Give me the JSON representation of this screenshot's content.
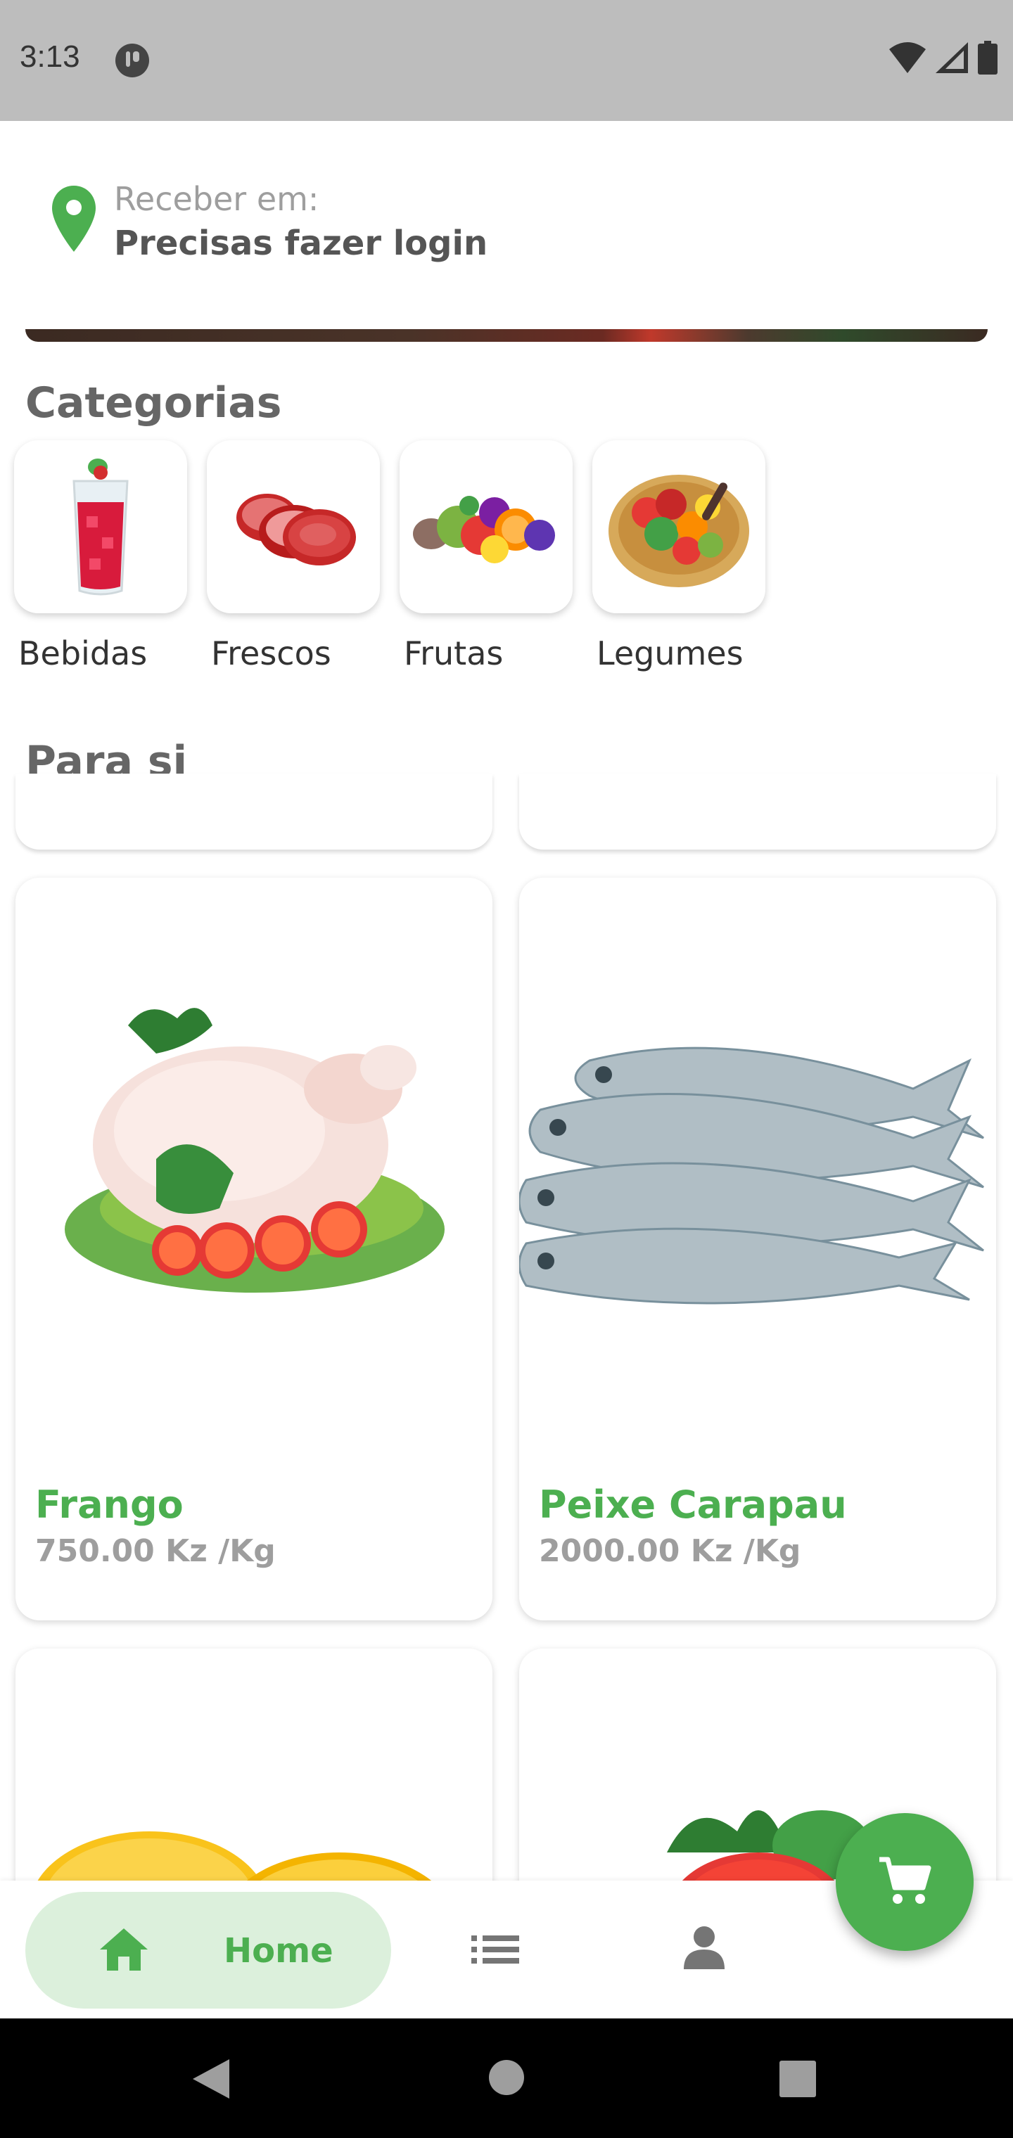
{
  "status_bar": {
    "time": "3:13",
    "icons": [
      "app-notification-icon",
      "wifi-icon",
      "cellular-signal-icon",
      "battery-icon"
    ]
  },
  "location": {
    "label": "Receber em:",
    "value": "Precisas fazer login",
    "icon": "map-pin-icon"
  },
  "sections": {
    "categories_title": "Categorias",
    "for_you_title": "Para si"
  },
  "categories": [
    {
      "label": "Bebidas",
      "icon": "drink-glass-image"
    },
    {
      "label": "Frescos",
      "icon": "raw-meat-image"
    },
    {
      "label": "Frutas",
      "icon": "fruits-image"
    },
    {
      "label": "Legumes",
      "icon": "vegetables-basket-image"
    }
  ],
  "products": [
    {
      "name": "Frango",
      "price": "750.00 Kz /Kg",
      "image": "chicken-image"
    },
    {
      "name": "Peixe Carapau",
      "price": "2000.00 Kz /Kg",
      "image": "mackerel-fish-image"
    },
    {
      "name": "",
      "price": "",
      "image": "papaya-image"
    },
    {
      "name": "",
      "price": "",
      "image": "strawberry-image"
    }
  ],
  "bottom_nav": {
    "items": [
      {
        "label": "Home",
        "icon": "home-icon",
        "active": true
      },
      {
        "label": "",
        "icon": "list-icon",
        "active": false
      },
      {
        "label": "",
        "icon": "profile-icon",
        "active": false
      }
    ],
    "fab_icon": "shopping-cart-icon"
  },
  "system_nav": [
    "back-icon",
    "home-circle-icon",
    "recents-icon"
  ],
  "colors": {
    "accent": "#4caf50",
    "accent_light": "#dcf0dc",
    "status_bar": "#bdbdbd",
    "muted_text": "#9e9e9e"
  }
}
